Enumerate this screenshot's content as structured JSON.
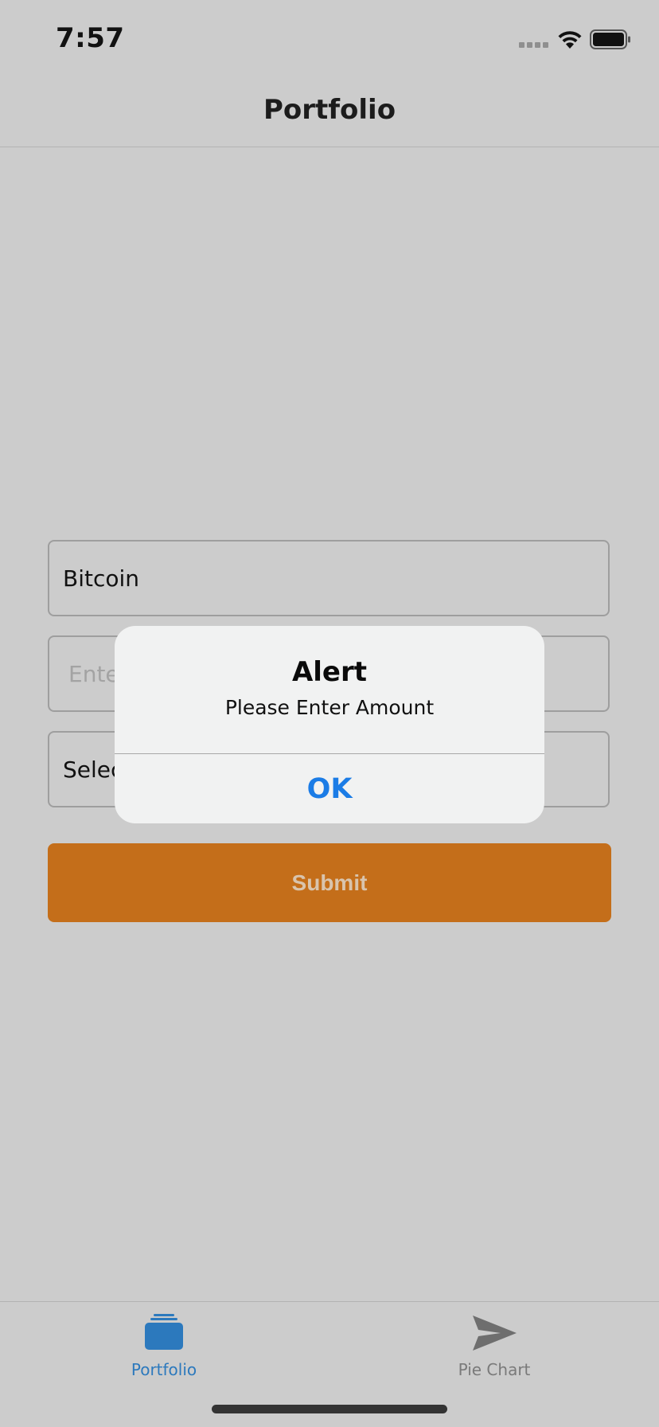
{
  "status_bar": {
    "time": "7:57",
    "signal_icon": "signal-dots-icon",
    "wifi_icon": "wifi-icon",
    "battery_icon": "battery-icon"
  },
  "nav": {
    "title": "Portfolio"
  },
  "form": {
    "coin_value": "Bitcoin",
    "amount_placeholder": "Ente",
    "select_value": "Selec",
    "submit_label": "Submit"
  },
  "alert": {
    "title": "Alert",
    "message": "Please Enter Amount",
    "ok_label": "OK"
  },
  "tabs": [
    {
      "label": "Portfolio",
      "icon": "stack-icon",
      "active": true,
      "color": "#2c79bd"
    },
    {
      "label": "Pie Chart",
      "icon": "send-arrow-icon",
      "active": false,
      "color": "#7a7a7a"
    }
  ],
  "colors": {
    "background": "#cccccc",
    "submit_button": "#c46e1a",
    "alert_action": "#1b7ce6",
    "tab_active": "#2c79bd",
    "tab_inactive": "#7a7a7a"
  }
}
